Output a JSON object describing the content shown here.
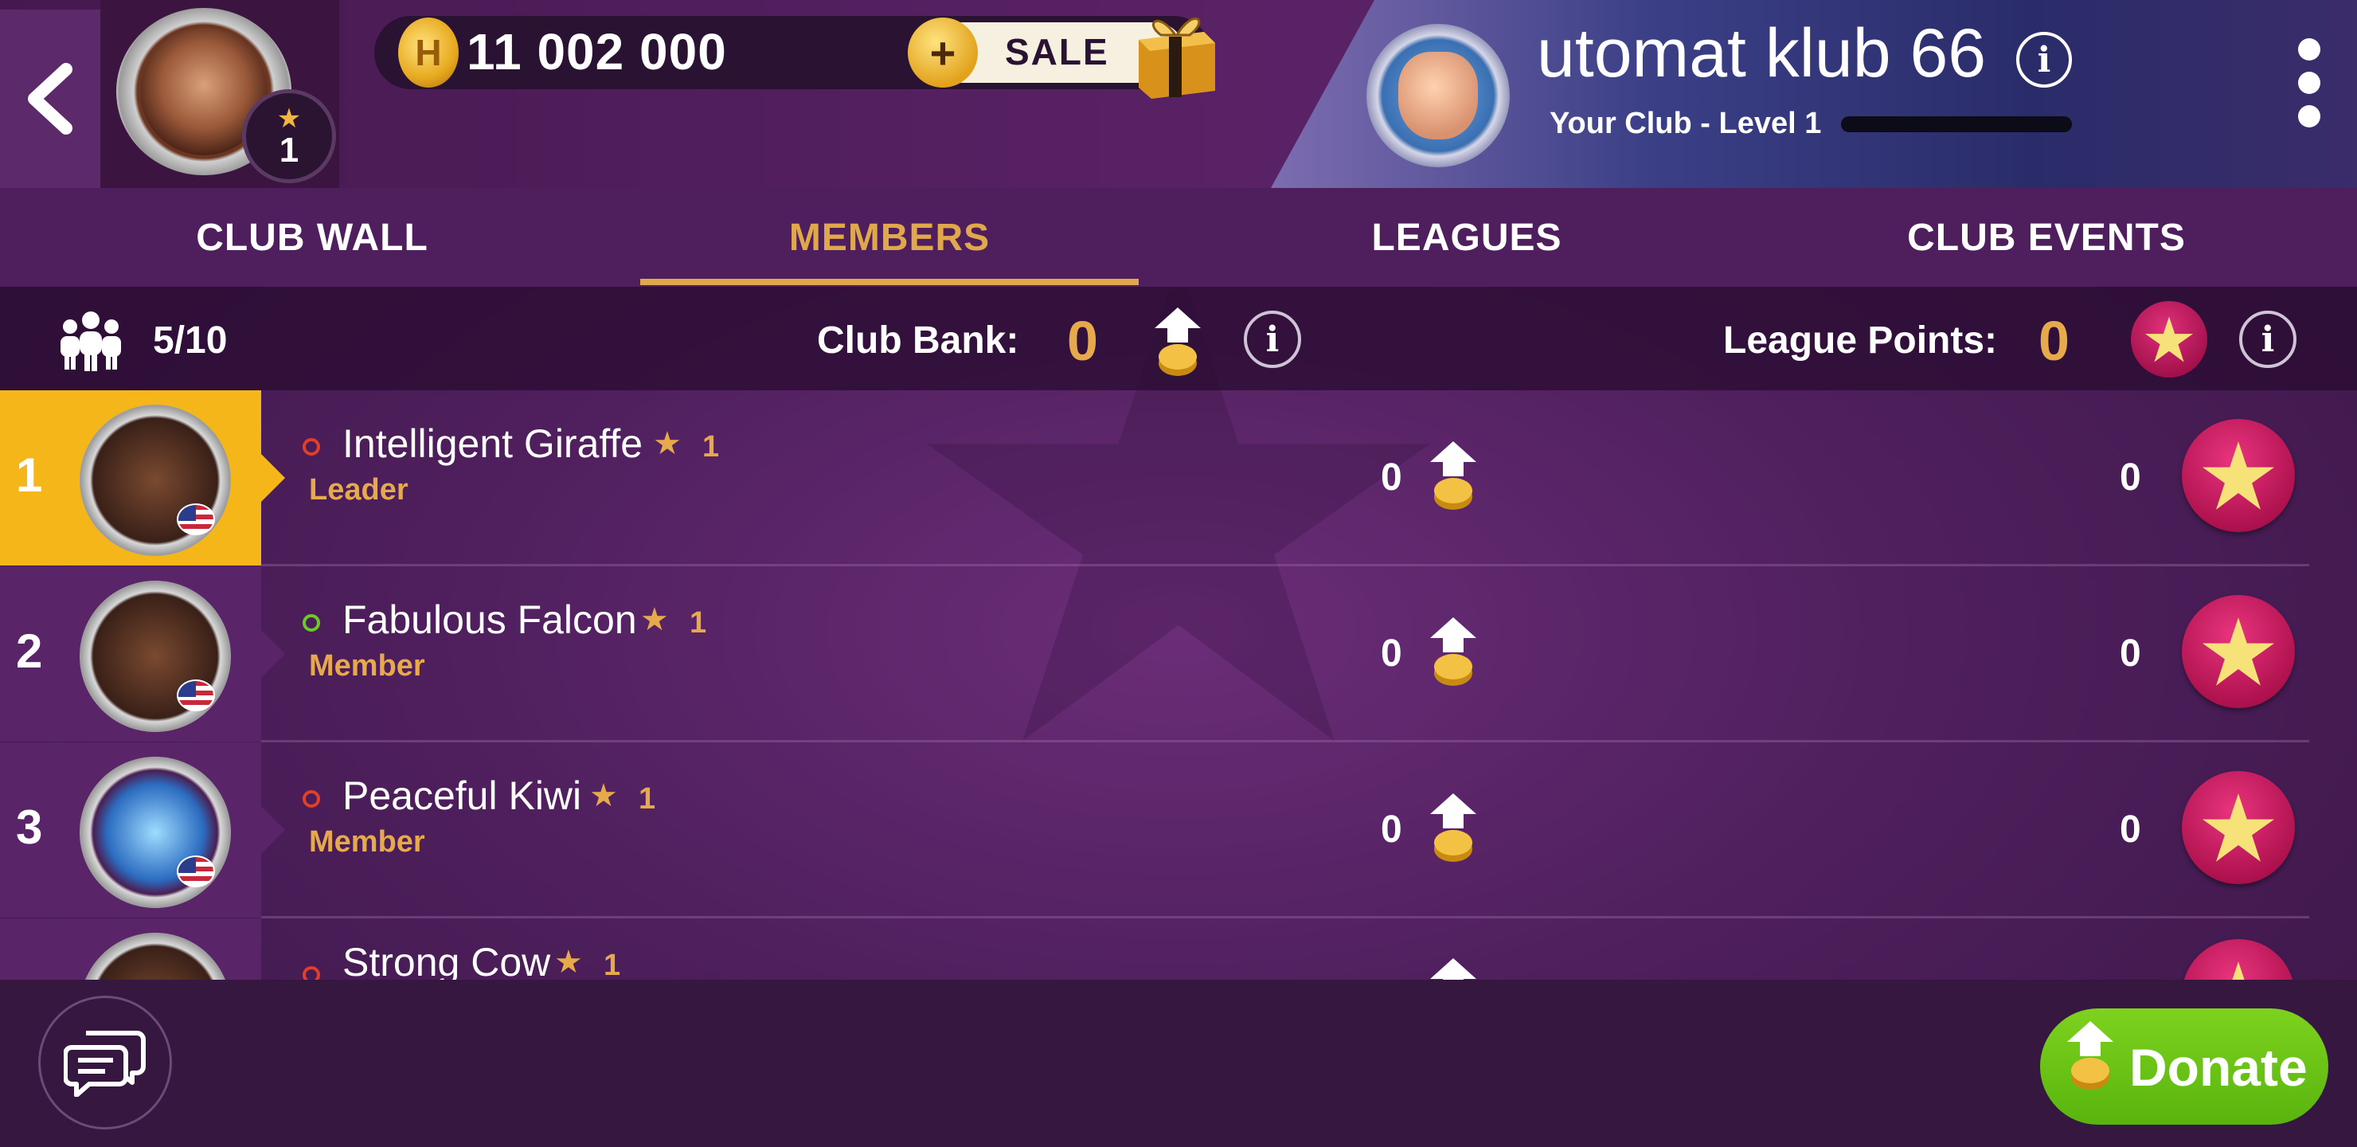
{
  "header": {
    "back_label": "",
    "player_level": "1",
    "coins": "11 002 000",
    "sale_label": "SALE",
    "club_name": "utomat klub 66",
    "club_level": "Your Club - Level 1"
  },
  "tabs": [
    {
      "label": "CLUB WALL",
      "active": false
    },
    {
      "label": "MEMBERS",
      "active": true
    },
    {
      "label": "LEAGUES",
      "active": false
    },
    {
      "label": "CLUB EVENTS",
      "active": false
    }
  ],
  "stats": {
    "member_count": "5/10",
    "club_bank_label": "Club Bank:",
    "club_bank_value": "0",
    "league_points_label": "League Points:",
    "league_points_value": "0"
  },
  "members": [
    {
      "rank": "1",
      "name": "Intelligent Giraffe",
      "level": "1",
      "role": "Leader",
      "donated": "0",
      "points": "0",
      "online": false
    },
    {
      "rank": "2",
      "name": "Fabulous Falcon",
      "level": "1",
      "role": "Member",
      "donated": "0",
      "points": "0",
      "online": true
    },
    {
      "rank": "3",
      "name": "Peaceful Kiwi",
      "level": "1",
      "role": "Member",
      "donated": "0",
      "points": "0",
      "online": false
    },
    {
      "rank": "",
      "name": "Strong Cow",
      "level": "1",
      "role": "",
      "donated": "",
      "points": "",
      "online": false
    }
  ],
  "footer": {
    "donate_label": "Donate"
  },
  "colors": {
    "accent_gold": "#e6aa4c",
    "leader_rank_bg": "#f5b61a",
    "donate_green": "#6ac418",
    "league_pink": "#c81a60"
  },
  "icons": [
    "back-arrow-icon",
    "star-icon",
    "coin-icon",
    "gift-icon",
    "club-emblem-icon",
    "info-icon",
    "kebab-menu-icon",
    "members-icon",
    "donate-coin-icon",
    "league-star-icon",
    "chat-icon",
    "us-flag-icon"
  ]
}
